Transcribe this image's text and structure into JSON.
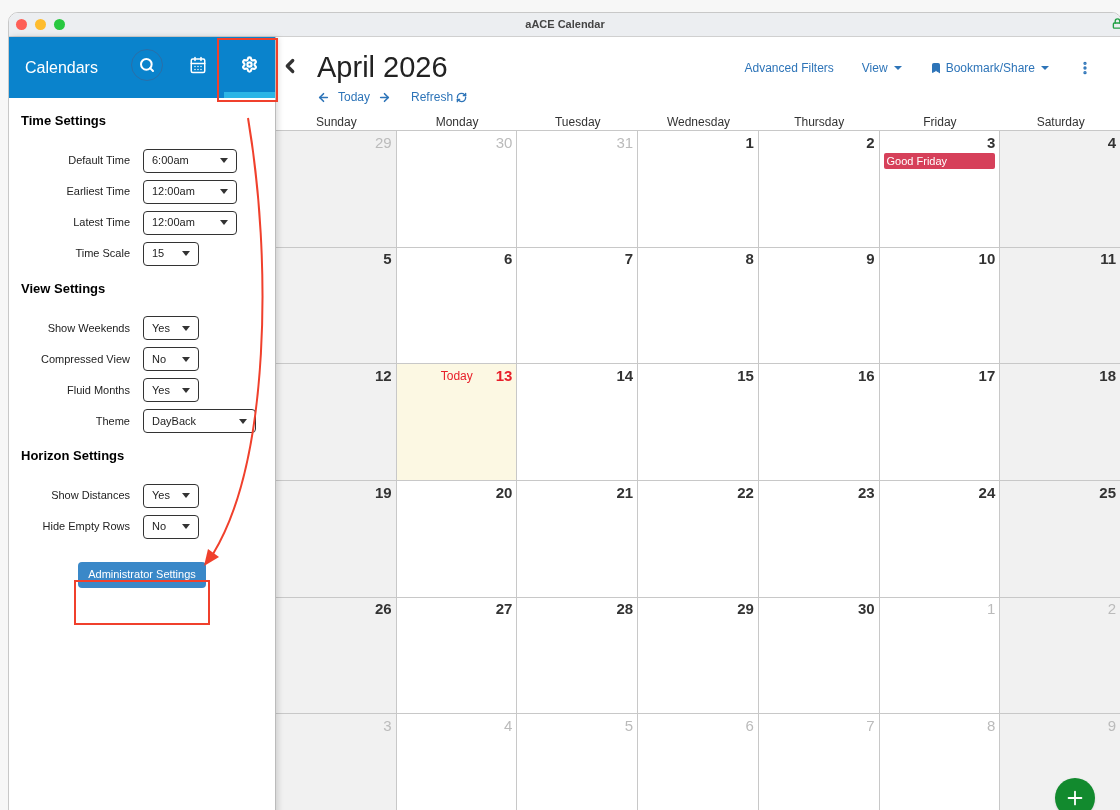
{
  "window": {
    "title": "aACE Calendar"
  },
  "sidebar": {
    "title": "Calendars",
    "tabs": [
      {
        "kind": "search",
        "selected": false
      },
      {
        "kind": "calendar",
        "selected": false
      },
      {
        "kind": "settings",
        "selected": true
      }
    ],
    "sections": [
      {
        "heading": "Time Settings",
        "rows": [
          {
            "label": "Default Time",
            "value": "6:00am",
            "kind": "time"
          },
          {
            "label": "Earliest Time",
            "value": "12:00am",
            "kind": "time"
          },
          {
            "label": "Latest Time",
            "value": "12:00am",
            "kind": "time"
          },
          {
            "label": "Time Scale",
            "value": "15",
            "kind": "choice"
          }
        ]
      },
      {
        "heading": "View Settings",
        "rows": [
          {
            "label": "Show Weekends",
            "value": "Yes",
            "kind": "choice"
          },
          {
            "label": "Compressed View",
            "value": "No",
            "kind": "choice"
          },
          {
            "label": "Fluid Months",
            "value": "Yes",
            "kind": "choice"
          },
          {
            "label": "Theme",
            "value": "DayBack",
            "kind": "theme"
          }
        ]
      },
      {
        "heading": "Horizon Settings",
        "rows": [
          {
            "label": "Show Distances",
            "value": "Yes",
            "kind": "choice"
          },
          {
            "label": "Hide Empty Rows",
            "value": "No",
            "kind": "choice"
          }
        ]
      }
    ],
    "button": "Administrator Settings"
  },
  "header": {
    "month": "April 2026",
    "today": "Today",
    "refresh": "Refresh",
    "actions": [
      {
        "label": "Advanced Filters",
        "kind": "link"
      },
      {
        "label": "View",
        "kind": "dropdown"
      },
      {
        "label": "Bookmark/Share",
        "kind": "bookmark"
      }
    ]
  },
  "weekdays": [
    {
      "name": "Sunday",
      "weekend": true
    },
    {
      "name": "Monday",
      "weekend": false
    },
    {
      "name": "Tuesday",
      "weekend": false
    },
    {
      "name": "Wednesday",
      "weekend": false
    },
    {
      "name": "Thursday",
      "weekend": false
    },
    {
      "name": "Friday",
      "weekend": false
    },
    {
      "name": "Saturday",
      "weekend": true
    }
  ],
  "weeks": [
    [
      {
        "day": "29",
        "muted": true
      },
      {
        "day": "30",
        "muted": true
      },
      {
        "day": "31",
        "muted": true
      },
      {
        "day": "1",
        "muted": false
      },
      {
        "day": "2",
        "muted": false
      },
      {
        "day": "3",
        "muted": false,
        "events": [
          {
            "title": "Good Friday",
            "color": "#d6405a"
          }
        ]
      },
      {
        "day": "4",
        "muted": false
      }
    ],
    [
      {
        "day": "5",
        "muted": false
      },
      {
        "day": "6",
        "muted": false
      },
      {
        "day": "7",
        "muted": false
      },
      {
        "day": "8",
        "muted": false
      },
      {
        "day": "9",
        "muted": false
      },
      {
        "day": "10",
        "muted": false
      },
      {
        "day": "11",
        "muted": false
      }
    ],
    [
      {
        "day": "12",
        "muted": false
      },
      {
        "day": "13",
        "muted": false,
        "today": "Today"
      },
      {
        "day": "14",
        "muted": false
      },
      {
        "day": "15",
        "muted": false
      },
      {
        "day": "16",
        "muted": false
      },
      {
        "day": "17",
        "muted": false
      },
      {
        "day": "18",
        "muted": false
      }
    ],
    [
      {
        "day": "19",
        "muted": false
      },
      {
        "day": "20",
        "muted": false
      },
      {
        "day": "21",
        "muted": false
      },
      {
        "day": "22",
        "muted": false
      },
      {
        "day": "23",
        "muted": false
      },
      {
        "day": "24",
        "muted": false
      },
      {
        "day": "25",
        "muted": false
      }
    ],
    [
      {
        "day": "26",
        "muted": false
      },
      {
        "day": "27",
        "muted": false
      },
      {
        "day": "28",
        "muted": false
      },
      {
        "day": "29",
        "muted": false
      },
      {
        "day": "30",
        "muted": false
      },
      {
        "day": "1",
        "muted": true
      },
      {
        "day": "2",
        "muted": true
      }
    ],
    [
      {
        "day": "3",
        "muted": true
      },
      {
        "day": "4",
        "muted": true
      },
      {
        "day": "5",
        "muted": true
      },
      {
        "day": "6",
        "muted": true
      },
      {
        "day": "7",
        "muted": true
      },
      {
        "day": "8",
        "muted": true
      },
      {
        "day": "9",
        "muted": true
      }
    ]
  ]
}
